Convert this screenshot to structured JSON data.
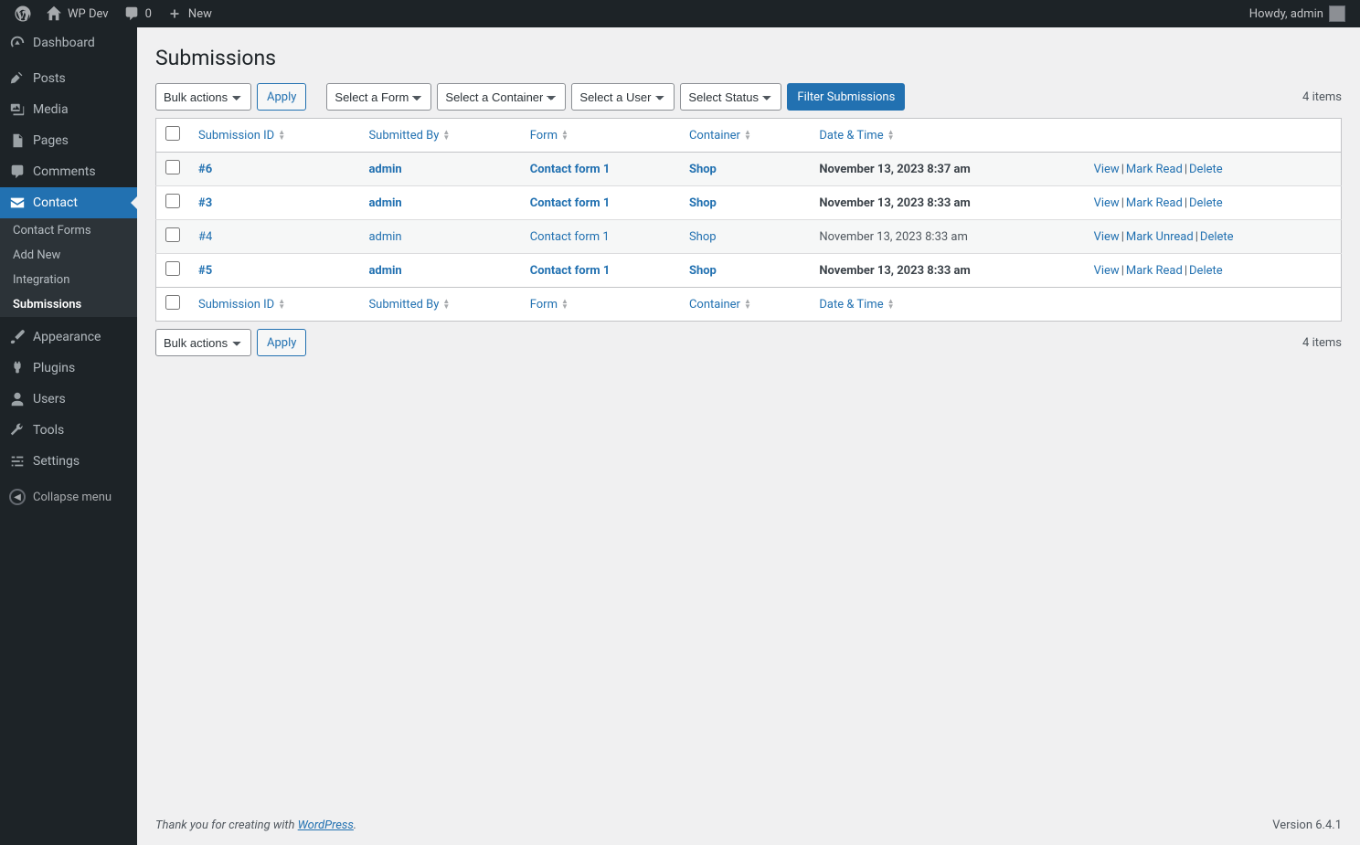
{
  "toolbar": {
    "site_name": "WP Dev",
    "comments_count": "0",
    "new_label": "New",
    "howdy_prefix": "Howdy, ",
    "username": "admin"
  },
  "sidebar": {
    "items": [
      {
        "key": "dashboard",
        "label": "Dashboard"
      },
      {
        "key": "posts",
        "label": "Posts"
      },
      {
        "key": "media",
        "label": "Media"
      },
      {
        "key": "pages",
        "label": "Pages"
      },
      {
        "key": "comments",
        "label": "Comments"
      },
      {
        "key": "contact",
        "label": "Contact"
      },
      {
        "key": "appearance",
        "label": "Appearance"
      },
      {
        "key": "plugins",
        "label": "Plugins"
      },
      {
        "key": "users",
        "label": "Users"
      },
      {
        "key": "tools",
        "label": "Tools"
      },
      {
        "key": "settings",
        "label": "Settings"
      }
    ],
    "contact_submenu": [
      {
        "key": "forms",
        "label": "Contact Forms"
      },
      {
        "key": "add",
        "label": "Add New"
      },
      {
        "key": "integration",
        "label": "Integration"
      },
      {
        "key": "submissions",
        "label": "Submissions"
      }
    ],
    "collapse_label": "Collapse menu"
  },
  "page": {
    "title": "Submissions",
    "bulk_actions_label": "Bulk actions",
    "apply_label": "Apply",
    "filter_form_label": "Select a Form",
    "filter_container_label": "Select a Container",
    "filter_user_label": "Select a User",
    "filter_status_label": "Select Status",
    "filter_button_label": "Filter Submissions",
    "items_count": "4 items",
    "columns": {
      "id": "Submission ID",
      "by": "Submitted By",
      "form": "Form",
      "container": "Container",
      "date": "Date & Time"
    },
    "actions": {
      "view": "View",
      "mark_read": "Mark Read",
      "mark_unread": "Mark Unread",
      "delete": "Delete"
    },
    "rows": [
      {
        "id": "#6",
        "by": "admin",
        "form": "Contact form 1",
        "container": "Shop",
        "date": "November 13, 2023 8:37 am",
        "unread": true
      },
      {
        "id": "#3",
        "by": "admin",
        "form": "Contact form 1",
        "container": "Shop",
        "date": "November 13, 2023 8:33 am",
        "unread": true
      },
      {
        "id": "#4",
        "by": "admin",
        "form": "Contact form 1",
        "container": "Shop",
        "date": "November 13, 2023 8:33 am",
        "unread": false
      },
      {
        "id": "#5",
        "by": "admin",
        "form": "Contact form 1",
        "container": "Shop",
        "date": "November 13, 2023 8:33 am",
        "unread": true
      }
    ]
  },
  "footer": {
    "thanks_prefix": "Thank you for creating with ",
    "wp_link": "WordPress",
    "thanks_suffix": ".",
    "version": "Version 6.4.1"
  }
}
